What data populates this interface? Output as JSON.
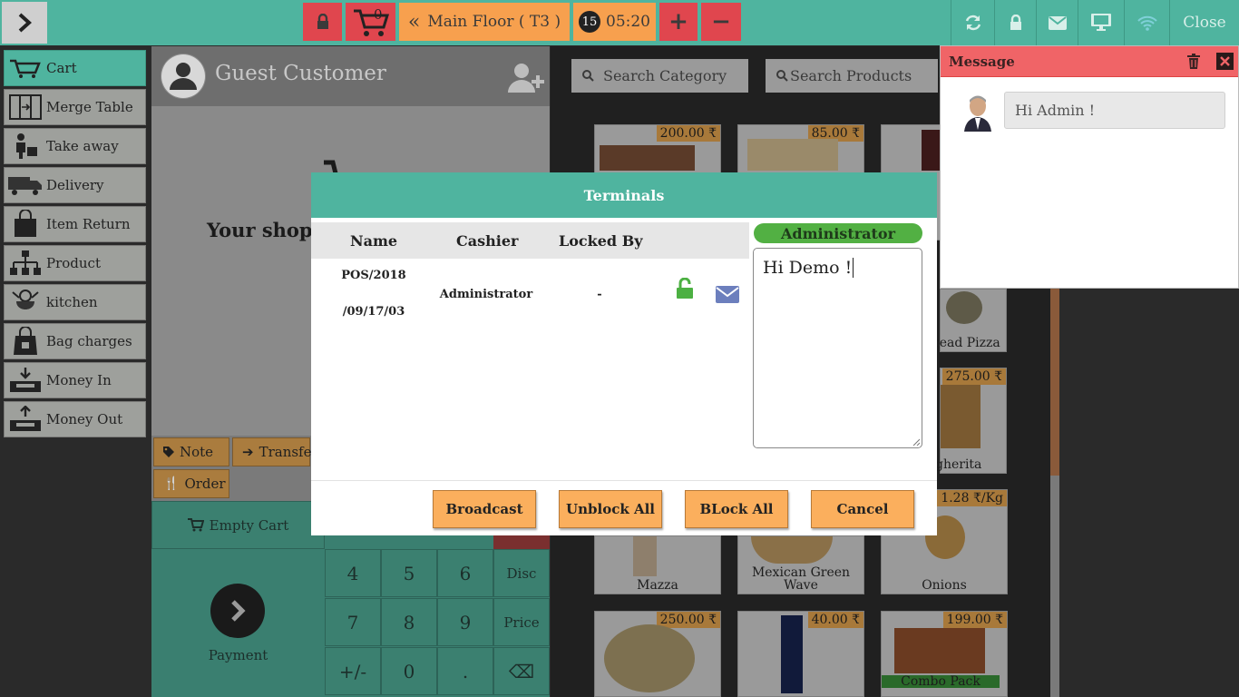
{
  "topbar": {
    "cart_count": "0",
    "floor_label": "Main Floor ( T3 )",
    "timer_badge": "15",
    "timer": "05:20",
    "plus": "+",
    "minus": "−",
    "close_label": "Close",
    "accent": "#4fb49f"
  },
  "sidebar": {
    "items": [
      {
        "label": "Cart",
        "icon": "cart-icon"
      },
      {
        "label": "Merge Table",
        "icon": "merge-table-icon"
      },
      {
        "label": "Take away",
        "icon": "take-away-icon"
      },
      {
        "label": "Delivery",
        "icon": "delivery-truck-icon"
      },
      {
        "label": "Item Return",
        "icon": "item-return-icon"
      },
      {
        "label": "Product",
        "icon": "product-icon"
      },
      {
        "label": "kitchen",
        "icon": "kitchen-icon"
      },
      {
        "label": "Bag charges",
        "icon": "bag-icon"
      },
      {
        "label": "Money In",
        "icon": "money-in-icon"
      },
      {
        "label": "Money Out",
        "icon": "money-out-icon"
      }
    ]
  },
  "customer": {
    "name": "Guest Customer"
  },
  "cart": {
    "empty_message": "Your shopp"
  },
  "actions": {
    "note": "Note",
    "transfer": "Transfer",
    "order": "Order",
    "empty_cart": "Empty Cart",
    "payment": "Payment"
  },
  "keypad": {
    "keys": [
      "4",
      "5",
      "6",
      "Disc",
      "7",
      "8",
      "9",
      "Price",
      "+/-",
      "0",
      ".",
      "⌫"
    ]
  },
  "search": {
    "category_placeholder": "Search Category",
    "products_placeholder": "Search Products"
  },
  "products": [
    {
      "name": "",
      "price": "200.00 ₹"
    },
    {
      "name": "",
      "price": "85.00 ₹"
    },
    {
      "name": "",
      "price": ""
    },
    {
      "name": "read Pizza",
      "price": ""
    },
    {
      "name": "gherita",
      "price": "275.00 ₹"
    },
    {
      "name": "Mazza",
      "price": ""
    },
    {
      "name": "Mexican Green Wave",
      "price": ""
    },
    {
      "name": "Onions",
      "price": "1.28 ₹/Kg"
    },
    {
      "name": "",
      "price": "250.00 ₹"
    },
    {
      "name": "",
      "price": "40.00 ₹"
    },
    {
      "name": "Combo Pack",
      "price": "199.00 ₹"
    }
  ],
  "message_panel": {
    "title": "Message",
    "bubble": "Hi Admin !"
  },
  "modal": {
    "title": "Terminals",
    "columns": [
      "Name",
      "Cashier",
      "Locked By"
    ],
    "rows": [
      {
        "name_line1": "POS/2018",
        "name_line2": "/09/17/03",
        "cashier": "Administrator",
        "locked_by": "-"
      }
    ],
    "recipient": "Administrator",
    "message_value": "Hi Demo !",
    "buttons": {
      "broadcast": "Broadcast",
      "unblock_all": "Unblock All",
      "block_all": "BLock All",
      "cancel": "Cancel"
    }
  }
}
